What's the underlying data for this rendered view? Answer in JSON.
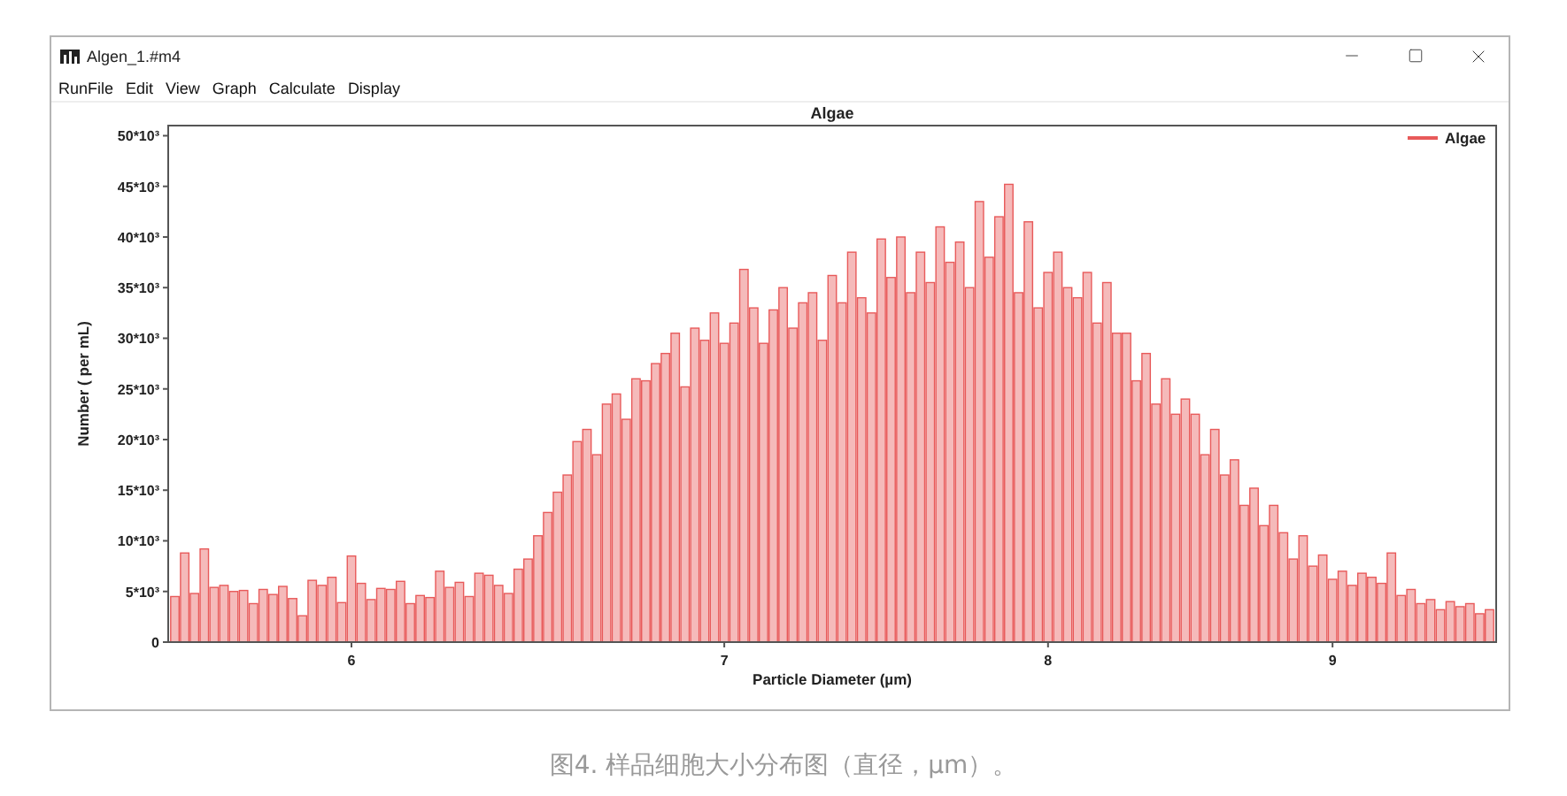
{
  "window": {
    "title": "Algen_1.#m4"
  },
  "menu": [
    {
      "label": "RunFile"
    },
    {
      "label": "Edit"
    },
    {
      "label": "View"
    },
    {
      "label": "Graph"
    },
    {
      "label": "Calculate"
    },
    {
      "label": "Display"
    }
  ],
  "chart": {
    "chart_data": {
      "type": "bar",
      "title": "Algae",
      "xlabel": "Particle Diameter (µm)",
      "ylabel": "Number ( per mL)",
      "categories": [
        null,
        null,
        null,
        null,
        null,
        null,
        null,
        null,
        null,
        null,
        null,
        null,
        null,
        null,
        null,
        null,
        null,
        null,
        "6",
        null,
        null,
        null,
        null,
        null,
        null,
        null,
        null,
        null,
        null,
        null,
        null,
        null,
        null,
        null,
        null,
        null,
        null,
        null,
        null,
        null,
        null,
        null,
        null,
        null,
        null,
        null,
        null,
        null,
        null,
        null,
        null,
        null,
        null,
        null,
        null,
        null,
        "7",
        null,
        null,
        null,
        null,
        null,
        null,
        null,
        null,
        null,
        null,
        null,
        null,
        null,
        null,
        null,
        null,
        null,
        null,
        null,
        null,
        null,
        null,
        null,
        null,
        null,
        null,
        null,
        null,
        null,
        null,
        null,
        null,
        "8",
        null,
        null,
        null,
        null,
        null,
        null,
        null,
        null,
        null,
        null,
        null,
        null,
        null,
        null,
        null,
        null,
        null,
        null,
        null,
        null,
        null,
        null,
        null,
        null,
        null,
        null,
        null,
        null,
        "9",
        null,
        null,
        null,
        null,
        null,
        null,
        null,
        null,
        null,
        null,
        null,
        null,
        null,
        null,
        null,
        null
      ],
      "series": [
        {
          "name": "Algae",
          "color": "#e85a5a",
          "values": [
            4500,
            8800,
            4800,
            9200,
            5400,
            5600,
            5000,
            5100,
            3800,
            5200,
            4700,
            5500,
            4300,
            2600,
            6100,
            5600,
            6400,
            3900,
            8500,
            5800,
            4200,
            5300,
            5200,
            6000,
            3800,
            4600,
            4400,
            7000,
            5400,
            5900,
            4500,
            6800,
            6600,
            5600,
            4800,
            7200,
            8200,
            10500,
            12800,
            14800,
            16500,
            19800,
            21000,
            18500,
            23500,
            24500,
            22000,
            26000,
            25800,
            27500,
            28500,
            30500,
            25200,
            31000,
            29800,
            32500,
            29500,
            31500,
            36800,
            33000,
            29500,
            32800,
            35000,
            31000,
            33500,
            34500,
            29800,
            36200,
            33500,
            38500,
            34000,
            32500,
            39800,
            36000,
            40000,
            34500,
            38500,
            35500,
            41000,
            37500,
            39500,
            35000,
            43500,
            38000,
            42000,
            45200,
            34500,
            41500,
            33000,
            36500,
            38500,
            35000,
            34000,
            36500,
            31500,
            35500,
            30500,
            30500,
            25800,
            28500,
            23500,
            26000,
            22500,
            24000,
            22500,
            18500,
            21000,
            16500,
            18000,
            13500,
            15200,
            11500,
            13500,
            10800,
            8200,
            10500,
            7500,
            8600,
            6200,
            7000,
            5600,
            6800,
            6400,
            5800,
            8800,
            4600,
            5200,
            3800,
            4200,
            3200,
            4000,
            3500,
            3800,
            2800,
            3200
          ]
        }
      ],
      "ylim": [
        0,
        51000
      ],
      "yticks": [
        {
          "value": 0,
          "label": "0"
        },
        {
          "value": 5000,
          "label": "5*10³"
        },
        {
          "value": 10000,
          "label": "10*10³"
        },
        {
          "value": 15000,
          "label": "15*10³"
        },
        {
          "value": 20000,
          "label": "20*10³"
        },
        {
          "value": 25000,
          "label": "25*10³"
        },
        {
          "value": 30000,
          "label": "30*10³"
        },
        {
          "value": 35000,
          "label": "35*10³"
        },
        {
          "value": 40000,
          "label": "40*10³"
        },
        {
          "value": 45000,
          "label": "45*10³"
        },
        {
          "value": 50000,
          "label": "50*10³"
        }
      ]
    }
  },
  "caption": "图4. 样品细胞大小分布图（直径，μm）。"
}
